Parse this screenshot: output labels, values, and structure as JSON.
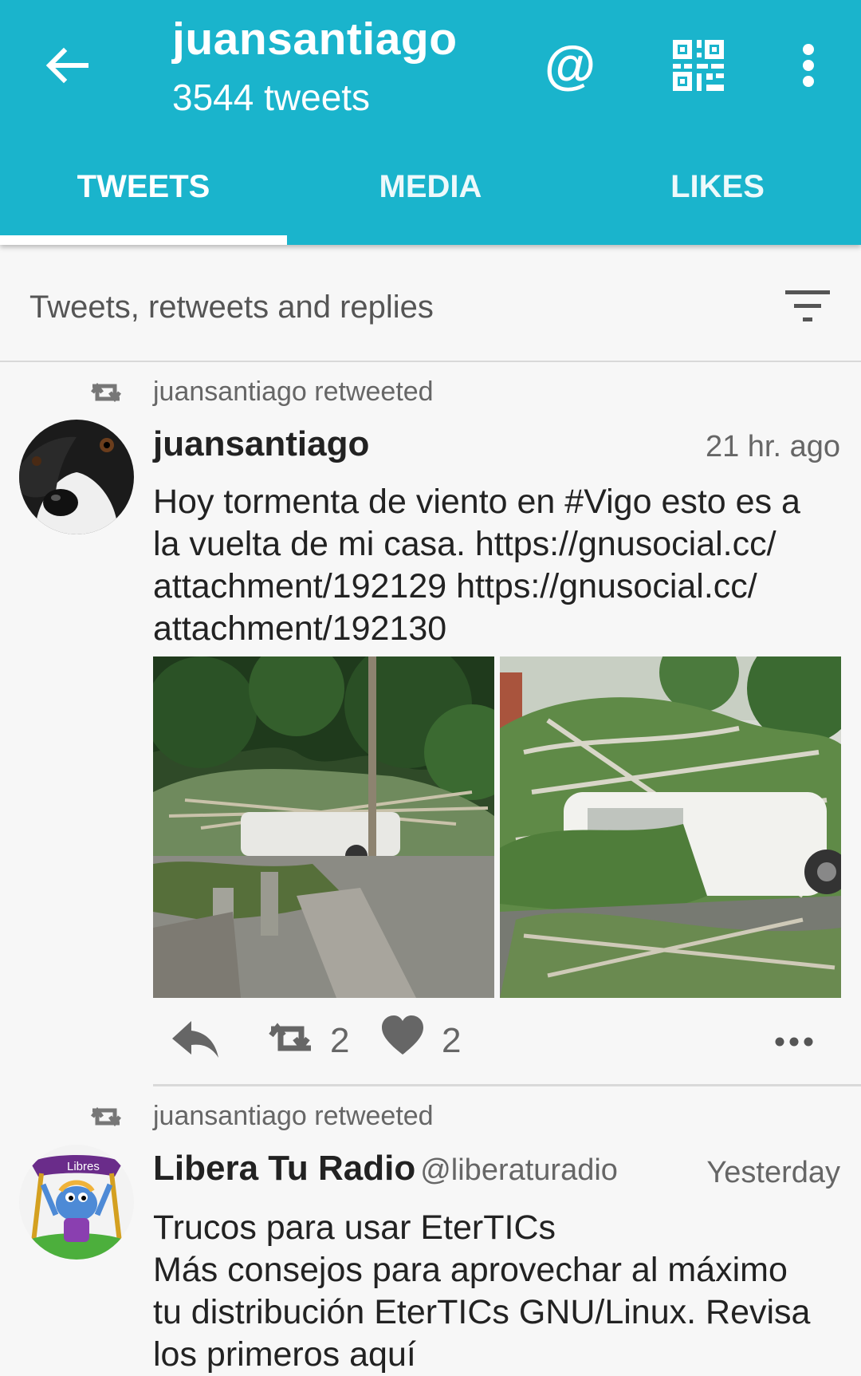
{
  "appbar": {
    "title": "juansantiago",
    "subtitle": "3544 tweets",
    "icons": [
      "back-arrow-icon",
      "at-sign-icon",
      "qr-code-icon",
      "overflow-menu-icon"
    ],
    "at_symbol": "@",
    "color": "#1ab4cc"
  },
  "tabs": [
    {
      "label": "TWEETS",
      "selected": true
    },
    {
      "label": "MEDIA",
      "selected": false
    },
    {
      "label": "LIKES",
      "selected": false
    }
  ],
  "filter": {
    "label": "Tweets, retweets and replies",
    "icon": "filter-icon"
  },
  "posts": [
    {
      "retweet_label": "juansantiago retweeted",
      "author": "juansantiago",
      "handle": "",
      "time": "21 hr. ago",
      "text": "Hoy tormenta de viento en #Vigo esto es a la vuelta de mi casa.  https://gnusocial.cc/attachment/192129  https://gnusocial.cc/attachment/192130",
      "text_lines": [
        "Hoy tormenta de viento en #Vigo esto es a",
        "la vuelta de mi casa.  https://gnusocial.cc/",
        "attachment/192129  https://gnusocial.cc/",
        "attachment/192130"
      ],
      "media": [
        "fallen-tree-street-photo",
        "fallen-tree-on-van-photo"
      ],
      "retweets": "2",
      "likes": "2"
    },
    {
      "retweet_label": "juansantiago retweeted",
      "author": "Libera Tu Radio",
      "handle": "@liberaturadio",
      "time": "Yesterday",
      "avatar_text": "Libres",
      "text_lines": [
        "Trucos para usar EterTICs",
        "Más consejos para aprovechar al máximo",
        "tu distribución EterTICs GNU/Linux. Revisa",
        "los primeros aquí"
      ]
    }
  ]
}
